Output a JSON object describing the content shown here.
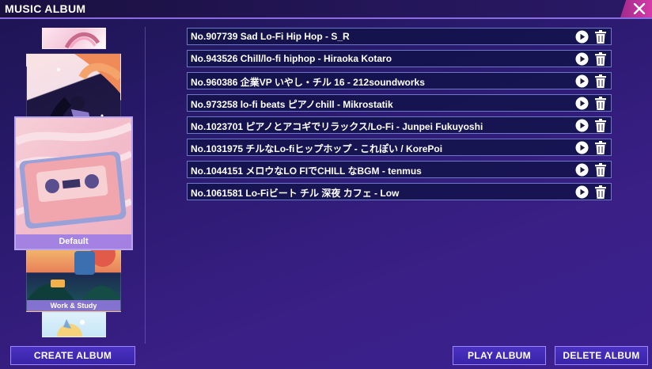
{
  "window": {
    "title": "MUSIC ALBUM"
  },
  "carousel": {
    "selected_label": "Default",
    "covers": [
      {
        "label": ""
      },
      {
        "label": ""
      },
      {
        "label": "Default"
      },
      {
        "label": "Work & Study"
      },
      {
        "label": ""
      }
    ]
  },
  "songs": [
    {
      "title": "No.907739 Sad Lo-Fi Hip Hop - S_R"
    },
    {
      "title": "No.943526 Chill/lo-fi hiphop - Hiraoka Kotaro"
    },
    {
      "title": "No.960386 企業VP いやし・チル 16 - 212soundworks"
    },
    {
      "title": "No.973258 lo-fi beats ピアノchill  - Mikrostatik"
    },
    {
      "title": "No.1023701 ピアノとアコギでリラックス/Lo-Fi - Junpei Fukuyoshi"
    },
    {
      "title": "No.1031975 チルなLo-fiヒップホップ  - これぽい / KorePoi"
    },
    {
      "title": "No.1044151 メロウなLO FIでCHILL なBGM  - tenmus"
    },
    {
      "title": "No.1061581 Lo-Fiビート チル 深夜 カフェ - Low"
    }
  ],
  "buttons": {
    "create_album": "CREATE ALBUM",
    "play_album": "PLAY ALBUM",
    "delete_album": "DELETE ALBUM"
  },
  "icons": {
    "close": "close-icon",
    "play": "play-icon",
    "trash": "trash-icon"
  },
  "colors": {
    "accent": "#d63aa8",
    "button": "#4a31c2",
    "row_border": "#6e78c9"
  }
}
